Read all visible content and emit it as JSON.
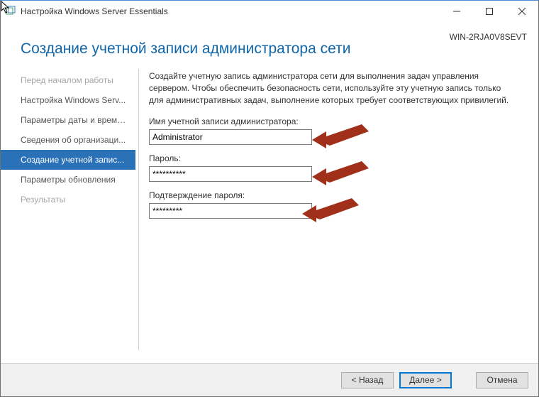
{
  "window": {
    "title": "Настройка Windows Server Essentials",
    "hostname": "WIN-2RJA0V8SEVT"
  },
  "heading": "Создание учетной записи администратора сети",
  "sidebar": {
    "items": [
      {
        "label": "Перед началом работы",
        "state": "inactive"
      },
      {
        "label": "Настройка Windows Serv...",
        "state": "normal"
      },
      {
        "label": "Параметры даты и време...",
        "state": "normal"
      },
      {
        "label": "Сведения об организаци...",
        "state": "normal"
      },
      {
        "label": "Создание учетной запис...",
        "state": "active"
      },
      {
        "label": "Параметры обновления",
        "state": "normal"
      },
      {
        "label": "Результаты",
        "state": "inactive"
      }
    ]
  },
  "content": {
    "description": "Создайте учетную запись администратора сети для выполнения задач управления сервером. Чтобы обеспечить безопасность сети, используйте эту учетную запись только для административных задач, выполнение которых требует соответствующих привилегий.",
    "admin_label": "Имя учетной записи администратора:",
    "admin_value": "Administrator",
    "password_label": "Пароль:",
    "password_value": "**********",
    "confirm_label": "Подтверждение пароля:",
    "confirm_value": "*********"
  },
  "footer": {
    "back": "< Назад",
    "next": "Далее >",
    "cancel": "Отмена"
  },
  "annotations": {
    "note": "Red arrows are instructional overlays, not part of the OS UI."
  }
}
